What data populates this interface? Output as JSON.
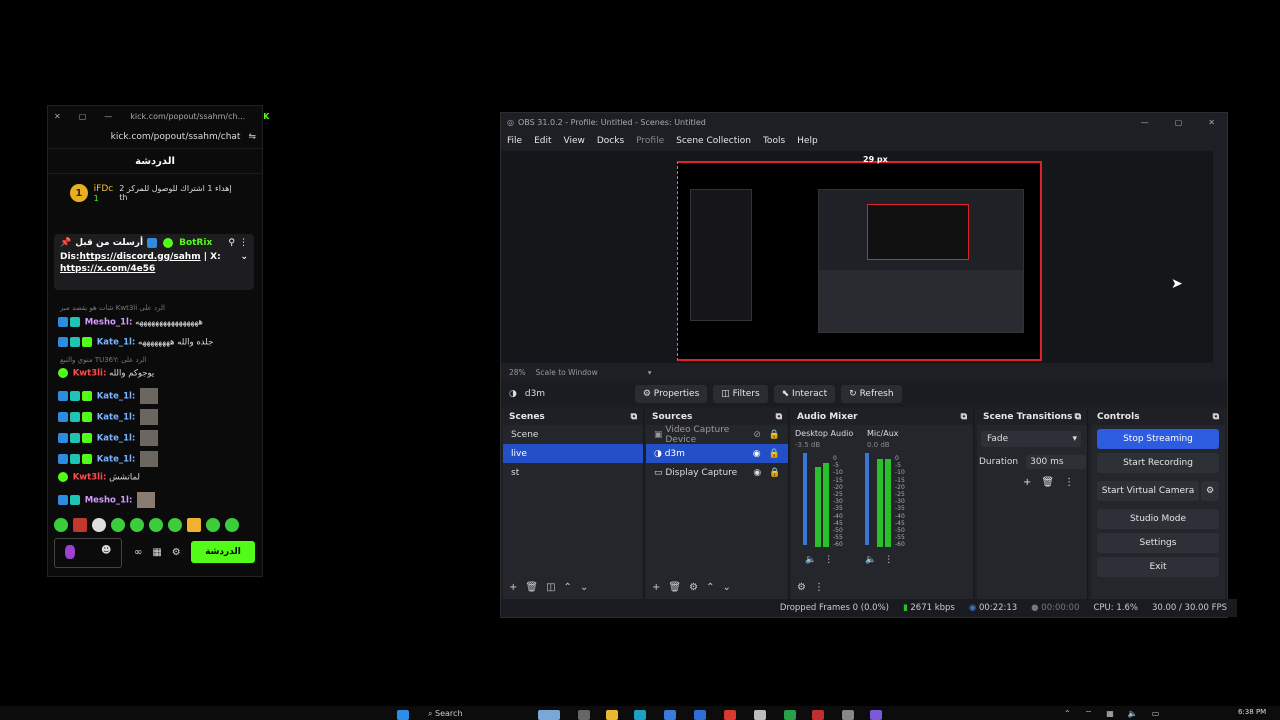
{
  "chat": {
    "title_bar": "kick.com/popout/ssahm/ch...",
    "url": "kick.com/popout/ssahm/chat",
    "header": "الدردشة",
    "goal": {
      "level": "1",
      "user": "iFDc",
      "count": "1",
      "text": "إهداء 1 اشتراك للوصول للمركز 2 th"
    },
    "pinned": {
      "label": "أرسلت من قبل",
      "user": "BotRix",
      "line1_prefix": "Dis:",
      "line1_link": "https://discord.gg/sahm",
      "line1_suffix": " | X:",
      "line2_link": "https://x.com/4e56"
    },
    "messages": [
      {
        "reply": "شات هو يقصد مبر Kwt3li الرد على",
        "user": "Mesho_1l:",
        "text": "ههههههههههههههههه",
        "user_color": "#d39bff"
      },
      {
        "reply": "",
        "user": "Kate_1l:",
        "text": "جلده والله ههههههههه",
        "user_color": "#79b4ff"
      },
      {
        "reply": "متوي والتبع TU36Y: الرد على",
        "user": "Kwt3li:",
        "text": "يوجوكم والله",
        "user_color": "#ff4d4d"
      },
      {
        "reply": "",
        "user": "Kate_1l:",
        "text": "",
        "user_color": "#79b4ff"
      },
      {
        "reply": "",
        "user": "Kate_1l:",
        "text": "",
        "user_color": "#79b4ff"
      },
      {
        "reply": "",
        "user": "Kate_1l:",
        "text": "",
        "user_color": "#79b4ff"
      },
      {
        "reply": "",
        "user": "Kate_1l:",
        "text": "",
        "user_color": "#79b4ff"
      },
      {
        "reply": "",
        "user": "Kwt3li:",
        "text": "لماتشش",
        "user_color": "#ff4d4d"
      },
      {
        "reply": "",
        "user": "Mesho_1l:",
        "text": "",
        "user_color": "#d39bff"
      }
    ],
    "send_label": "الدردشة"
  },
  "obs": {
    "title": "OBS 31.0.2 - Profile: Untitled - Scenes: Untitled",
    "menu": [
      "File",
      "Edit",
      "View",
      "Docks",
      "Profile",
      "Scene Collection",
      "Tools",
      "Help"
    ],
    "preview_label": "29 px",
    "zoom": "28%",
    "scale_mode": "Scale to Window",
    "selected_source": "d3m",
    "context_buttons": [
      "Properties",
      "Filters",
      "Interact",
      "Refresh"
    ],
    "scenes": {
      "title": "Scenes",
      "items": [
        "Scene",
        "live",
        "st"
      ],
      "selected": "live"
    },
    "sources": {
      "title": "Sources",
      "items": [
        "Video Capture Device",
        "d3m",
        "Display Capture"
      ],
      "selected": "d3m"
    },
    "mixer": {
      "title": "Audio Mixer",
      "channels": [
        {
          "name": "Desktop Audio",
          "db": "-3.5 dB"
        },
        {
          "name": "Mic/Aux",
          "db": "0.0 dB"
        }
      ],
      "scale": [
        "0",
        "-5",
        "-10",
        "-15",
        "-20",
        "-25",
        "-30",
        "-35",
        "-40",
        "-45",
        "-50",
        "-55",
        "-60"
      ]
    },
    "transitions": {
      "title": "Scene Transitions",
      "type": "Fade",
      "duration_label": "Duration",
      "duration": "300 ms"
    },
    "controls": {
      "title": "Controls",
      "buttons": [
        "Stop Streaming",
        "Start Recording",
        "Start Virtual Camera",
        "Studio Mode",
        "Settings",
        "Exit"
      ]
    },
    "status": {
      "dropped": "Dropped Frames 0 (0.0%)",
      "bitrate": "2671 kbps",
      "live_time": "00:22:13",
      "rec_time": "00:00:00",
      "cpu": "CPU: 1.6%",
      "fps": "30.00 / 30.00 FPS"
    }
  },
  "taskbar": {
    "search": "Search",
    "clock": "6:38 PM"
  },
  "colors": {
    "kick_green": "#53fc18",
    "obs_blue": "#2d5ce0",
    "selection_red": "#e0202a"
  }
}
